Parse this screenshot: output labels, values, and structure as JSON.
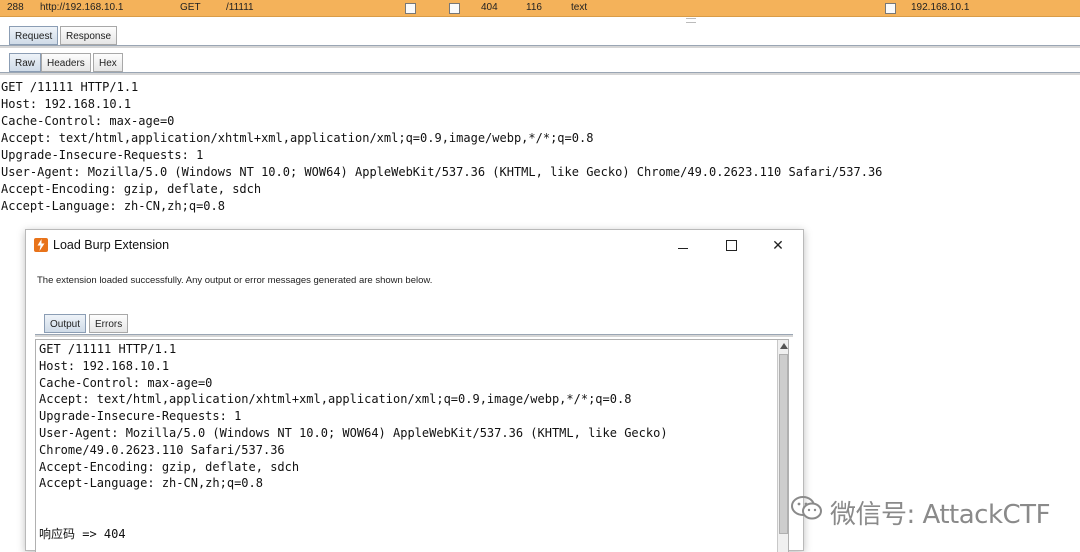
{
  "history_row": {
    "number": "288",
    "host": "http://192.168.10.1",
    "method": "GET",
    "url": "/11111",
    "status": "404",
    "length": "116",
    "mime": "text",
    "ip": "192.168.10.1"
  },
  "message_tabs": [
    {
      "label": "Request",
      "selected": true
    },
    {
      "label": "Response",
      "selected": false
    }
  ],
  "view_tabs": [
    {
      "label": "Raw",
      "selected": true
    },
    {
      "label": "Headers",
      "selected": false
    },
    {
      "label": "Hex",
      "selected": false
    }
  ],
  "request_lines": [
    "GET /11111 HTTP/1.1",
    "Host: 192.168.10.1",
    "Cache-Control: max-age=0",
    "Accept: text/html,application/xhtml+xml,application/xml;q=0.9,image/webp,*/*;q=0.8",
    "Upgrade-Insecure-Requests: 1",
    "User-Agent: Mozilla/5.0 (Windows NT 10.0; WOW64) AppleWebKit/537.36 (KHTML, like Gecko) Chrome/49.0.2623.110 Safari/537.36",
    "Accept-Encoding: gzip, deflate, sdch",
    "Accept-Language: zh-CN,zh;q=0.8"
  ],
  "dialog": {
    "title": "Load Burp Extension",
    "minimize_glyph": "",
    "maximize_glyph": "",
    "close_glyph": "✕",
    "info": "The extension loaded successfully. Any output or error messages generated are shown below.",
    "tabs": [
      {
        "label": "Output",
        "selected": true
      },
      {
        "label": "Errors",
        "selected": false
      }
    ],
    "output_lines": [
      "GET /11111 HTTP/1.1",
      "Host: 192.168.10.1",
      "Cache-Control: max-age=0",
      "Accept: text/html,application/xhtml+xml,application/xml;q=0.9,image/webp,*/*;q=0.8",
      "Upgrade-Insecure-Requests: 1",
      "User-Agent: Mozilla/5.0 (Windows NT 10.0; WOW64) AppleWebKit/537.36 (KHTML, like Gecko)",
      "Chrome/49.0.2623.110 Safari/537.36",
      "Accept-Encoding: gzip, deflate, sdch",
      "Accept-Language: zh-CN,zh;q=0.8",
      "",
      "",
      "响应码 => 404"
    ]
  },
  "watermark": {
    "text": "微信号: AttackCTF",
    "icon": "wechat-icon"
  },
  "colors": {
    "history_highlight": "#f4b25a",
    "burp_orange": "#e8731a"
  }
}
